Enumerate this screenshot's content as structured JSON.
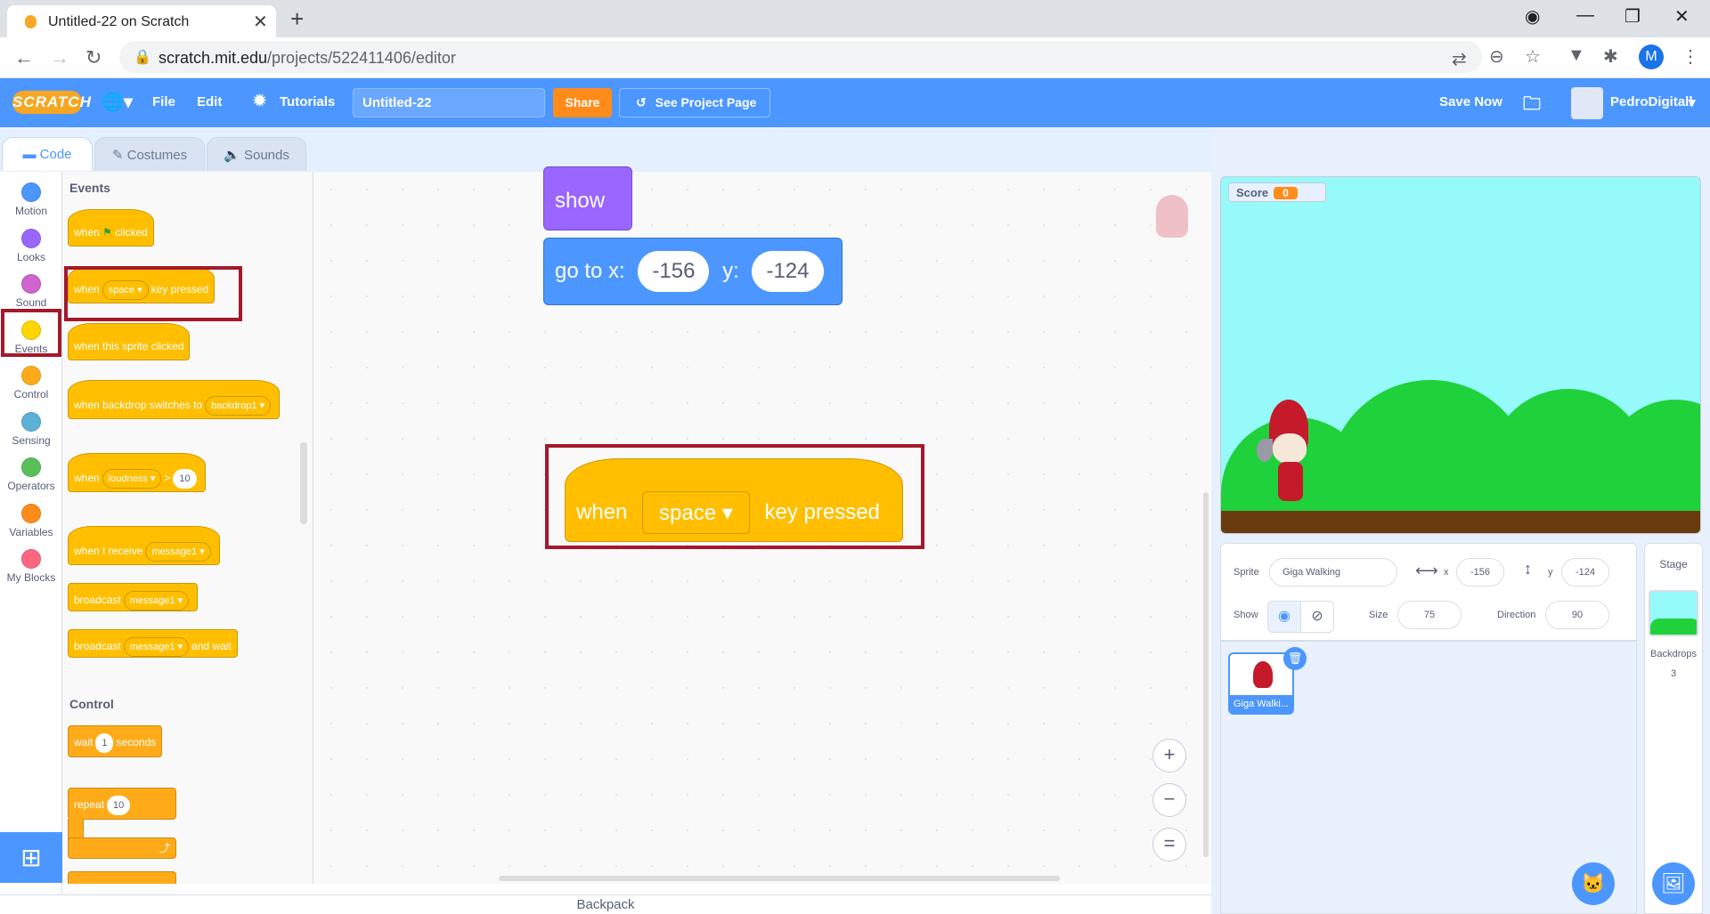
{
  "browser": {
    "tab_title": "Untitled-22 on Scratch",
    "url_host": "scratch.mit.edu",
    "url_path": "/projects/522411406/editor",
    "profile_initial": "M"
  },
  "menu": {
    "logo": "SCRATCH",
    "file": "File",
    "edit": "Edit",
    "tutorials": "Tutorials",
    "project_title": "Untitled-22",
    "share": "Share",
    "see_project": "See Project Page",
    "save_now": "Save Now",
    "username": "PedroDigitall"
  },
  "tabs": {
    "code": "Code",
    "costumes": "Costumes",
    "sounds": "Sounds"
  },
  "categories": [
    {
      "label": "Motion",
      "color": "#4c97ff"
    },
    {
      "label": "Looks",
      "color": "#9966ff"
    },
    {
      "label": "Sound",
      "color": "#cf63cf"
    },
    {
      "label": "Events",
      "color": "#ffd500"
    },
    {
      "label": "Control",
      "color": "#ffab19"
    },
    {
      "label": "Sensing",
      "color": "#5cb1d6"
    },
    {
      "label": "Operators",
      "color": "#59c059"
    },
    {
      "label": "Variables",
      "color": "#ff8c1a"
    },
    {
      "label": "My Blocks",
      "color": "#ff6680"
    }
  ],
  "palette": {
    "events_title": "Events",
    "when": "when",
    "clicked": "clicked",
    "key_opt": "space",
    "key_pressed": "key pressed",
    "sprite_clicked": "when this sprite clicked",
    "backdrop_switches": "when backdrop switches to",
    "backdrop_opt": "backdrop1",
    "loudness_opt": "loudness",
    "gt": ">",
    "loudness_val": "10",
    "receive": "when I receive",
    "message_opt": "message1",
    "broadcast": "broadcast",
    "and_wait": "and wait",
    "control_title": "Control",
    "wait": "wait",
    "wait_val": "1",
    "seconds": "seconds",
    "repeat": "repeat",
    "repeat_val": "10"
  },
  "script": {
    "show": "show",
    "goto_x": "go to x:",
    "x_val": "-156",
    "y_lbl": "y:",
    "y_val": "-124",
    "when": "when",
    "key_opt": "space",
    "key_pressed": "key pressed"
  },
  "backpack": "Backpack",
  "stage": {
    "score_label": "Score",
    "score_value": "0"
  },
  "sprite_info": {
    "sprite_lbl": "Sprite",
    "sprite_name": "Giga Walking",
    "x_lbl": "x",
    "x": "-156",
    "y_lbl": "y",
    "y": "-124",
    "show_lbl": "Show",
    "size_lbl": "Size",
    "size": "75",
    "dir_lbl": "Direction",
    "direction": "90"
  },
  "sprites": [
    {
      "name": "Giga Walki..."
    }
  ],
  "stage_pane": {
    "title": "Stage",
    "backdrops_lbl": "Backdrops",
    "backdrops": "3"
  }
}
